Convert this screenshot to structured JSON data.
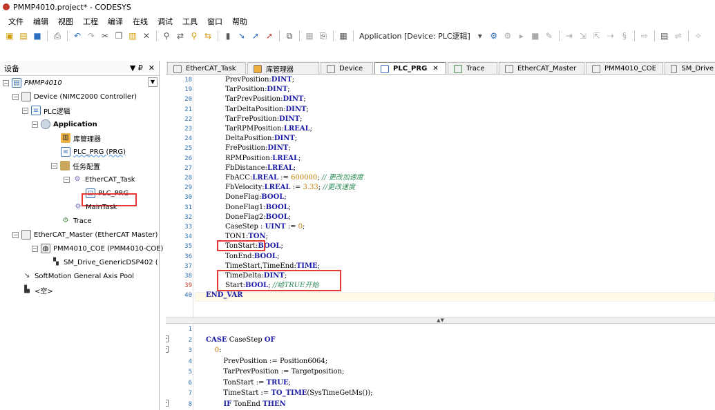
{
  "window": {
    "title": "PMMP4010.project* - CODESYS"
  },
  "menu": [
    "文件",
    "编辑",
    "视图",
    "工程",
    "编译",
    "在线",
    "调试",
    "工具",
    "窗口",
    "帮助"
  ],
  "toolbar": {
    "application_label": "Application [Device: PLC逻辑]"
  },
  "devices_panel": {
    "title": "设备",
    "pin": "▼ ₽",
    "close": "✕"
  },
  "tree": [
    {
      "label": "PMMP4010",
      "icon": "project-icon",
      "level": 0
    },
    {
      "label": "Device (NIMC2000 Controller)",
      "icon": "device-icon",
      "level": 1
    },
    {
      "label": "PLC逻辑",
      "icon": "plc-logic-icon",
      "level": 2
    },
    {
      "label": "Application",
      "icon": "application-icon",
      "level": 3
    },
    {
      "label": "库管理器",
      "icon": "library-manager-icon",
      "level": 4
    },
    {
      "label": "PLC_PRG (PRG)",
      "icon": "pou-icon",
      "level": 4
    },
    {
      "label": "任务配置",
      "icon": "task-config-icon",
      "level": 4
    },
    {
      "label": "EtherCAT_Task",
      "icon": "task-icon",
      "level": 5
    },
    {
      "label": "PLC_PRG",
      "icon": "task-call-icon",
      "level": 6
    },
    {
      "label": "MainTask",
      "icon": "task-icon",
      "level": 5
    },
    {
      "label": "Trace",
      "icon": "trace-icon",
      "level": 4
    },
    {
      "label": "EtherCAT_Master (EtherCAT Master)",
      "icon": "device-icon",
      "level": 1
    },
    {
      "label": "PMM4010_COE (PMM4010-COE)",
      "icon": "slave-icon",
      "level": 2
    },
    {
      "label": "SM_Drive_GenericDSP402 (",
      "icon": "axis-drive-icon",
      "level": 3
    },
    {
      "label": "SoftMotion General Axis Pool",
      "icon": "axis-pool-icon",
      "level": 1
    },
    {
      "label": "<空>",
      "icon": "empty-icon",
      "level": 1
    }
  ],
  "tabs": [
    {
      "label": "EtherCAT_Task"
    },
    {
      "label": "库管理器"
    },
    {
      "label": "Device"
    },
    {
      "label": "PLC_PRG",
      "active": true
    },
    {
      "label": "Trace"
    },
    {
      "label": "EtherCAT_Master"
    },
    {
      "label": "PMM4010_COE"
    },
    {
      "label": "SM_Drive"
    }
  ],
  "declaration_lines": [
    {
      "n": "18",
      "text": "PrevPosition:DINT;"
    },
    {
      "n": "19",
      "text": "TarPosition:DINT;"
    },
    {
      "n": "20",
      "text": "TarPrevPosition:DINT;"
    },
    {
      "n": "21",
      "text": "TarDeltaPosition:DINT;"
    },
    {
      "n": "22",
      "text": "TarFrePosition:DINT;"
    },
    {
      "n": "23",
      "text": "TarRPMPosition:LREAL;"
    },
    {
      "n": "24",
      "text": "DeltaPosition:DINT;"
    },
    {
      "n": "25",
      "text": "FrePosition:DINT;"
    },
    {
      "n": "26",
      "text": "RPMPosition:LREAL;"
    },
    {
      "n": "27",
      "text": "FbDistance:LREAL;"
    },
    {
      "n": "28",
      "text": "FbACC:LREAL := 600000; // 更改加速度"
    },
    {
      "n": "29",
      "text": "FbVelocity:LREAL := 3.33; //更改速度"
    },
    {
      "n": "30",
      "text": "DoneFlag:BOOL;"
    },
    {
      "n": "31",
      "text": "DoneFlag1:BOOL;"
    },
    {
      "n": "32",
      "text": "DoneFlag2:BOOL;"
    },
    {
      "n": "33",
      "text": "CaseStep : UINT := 0;"
    },
    {
      "n": "34",
      "text": "TON1:TON;"
    },
    {
      "n": "35",
      "text": "TonStart:BOOL;"
    },
    {
      "n": "36",
      "text": "TonEnd:BOOL;"
    },
    {
      "n": "37",
      "text": "TimeStart,TimeEnd:TIME;"
    },
    {
      "n": "38",
      "text": "TimeDelta:DINT;"
    },
    {
      "n": "39",
      "text": "Start:BOOL; //给TRUE开始"
    },
    {
      "n": "40",
      "text": "END_VAR"
    }
  ],
  "implementation_lines": [
    {
      "n": "1",
      "text": ""
    },
    {
      "n": "2",
      "text": "CASE CaseStep OF"
    },
    {
      "n": "3",
      "text": "    0:"
    },
    {
      "n": "4",
      "text": "        PrevPosition := Position6064;"
    },
    {
      "n": "5",
      "text": "        TarPrevPosition := Targetposition;"
    },
    {
      "n": "6",
      "text": "        TonStart := TRUE;"
    },
    {
      "n": "7",
      "text": "        TimeStart := TO_TIME(SysTimeGetMs());"
    },
    {
      "n": "8",
      "text": "        IF TonEnd THEN"
    }
  ]
}
